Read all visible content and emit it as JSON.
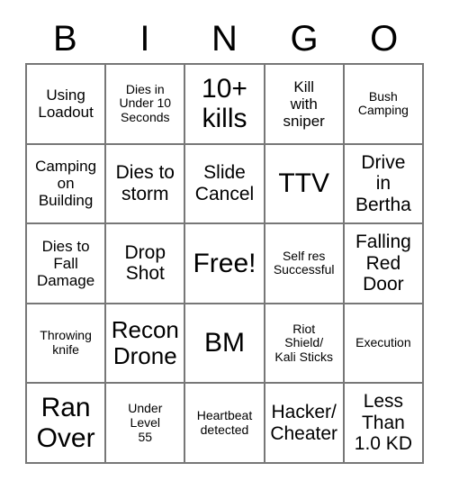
{
  "card": {
    "title": "BINGO",
    "header_letters": [
      "B",
      "I",
      "N",
      "G",
      "O"
    ],
    "colors": {
      "background": "#ffffff",
      "text": "#000000",
      "grid_line": "#777777"
    },
    "rows": [
      [
        {
          "text": "Using\nLoadout",
          "size": "fs-md"
        },
        {
          "text": "Dies in\nUnder 10\nSeconds",
          "size": "fs-sm"
        },
        {
          "text": "10+\nkills",
          "size": "fs-xxl"
        },
        {
          "text": "Kill\nwith\nsniper",
          "size": "fs-md"
        },
        {
          "text": "Bush\nCamping",
          "size": "fs-sm"
        }
      ],
      [
        {
          "text": "Camping\non\nBuilding",
          "size": "fs-md"
        },
        {
          "text": "Dies to\nstorm",
          "size": "fs-lg"
        },
        {
          "text": "Slide\nCancel",
          "size": "fs-lg"
        },
        {
          "text": "TTV",
          "size": "fs-xxl"
        },
        {
          "text": "Drive\nin\nBertha",
          "size": "fs-lg"
        }
      ],
      [
        {
          "text": "Dies to\nFall\nDamage",
          "size": "fs-md"
        },
        {
          "text": "Drop\nShot",
          "size": "fs-lg"
        },
        {
          "text": "Free!",
          "size": "fs-xxl"
        },
        {
          "text": "Self res\nSuccessful",
          "size": "fs-sm"
        },
        {
          "text": "Falling\nRed\nDoor",
          "size": "fs-lg"
        }
      ],
      [
        {
          "text": "Throwing\nknife",
          "size": "fs-sm"
        },
        {
          "text": "Recon\nDrone",
          "size": "fs-xl"
        },
        {
          "text": "BM",
          "size": "fs-xxl"
        },
        {
          "text": "Riot\nShield/\nKali Sticks",
          "size": "fs-sm"
        },
        {
          "text": "Execution",
          "size": "fs-sm"
        }
      ],
      [
        {
          "text": "Ran\nOver",
          "size": "fs-xxl"
        },
        {
          "text": "Under\nLevel\n55",
          "size": "fs-sm"
        },
        {
          "text": "Heartbeat\ndetected",
          "size": "fs-sm"
        },
        {
          "text": "Hacker/\nCheater",
          "size": "fs-lg"
        },
        {
          "text": "Less\nThan\n1.0 KD",
          "size": "fs-lg"
        }
      ]
    ]
  }
}
